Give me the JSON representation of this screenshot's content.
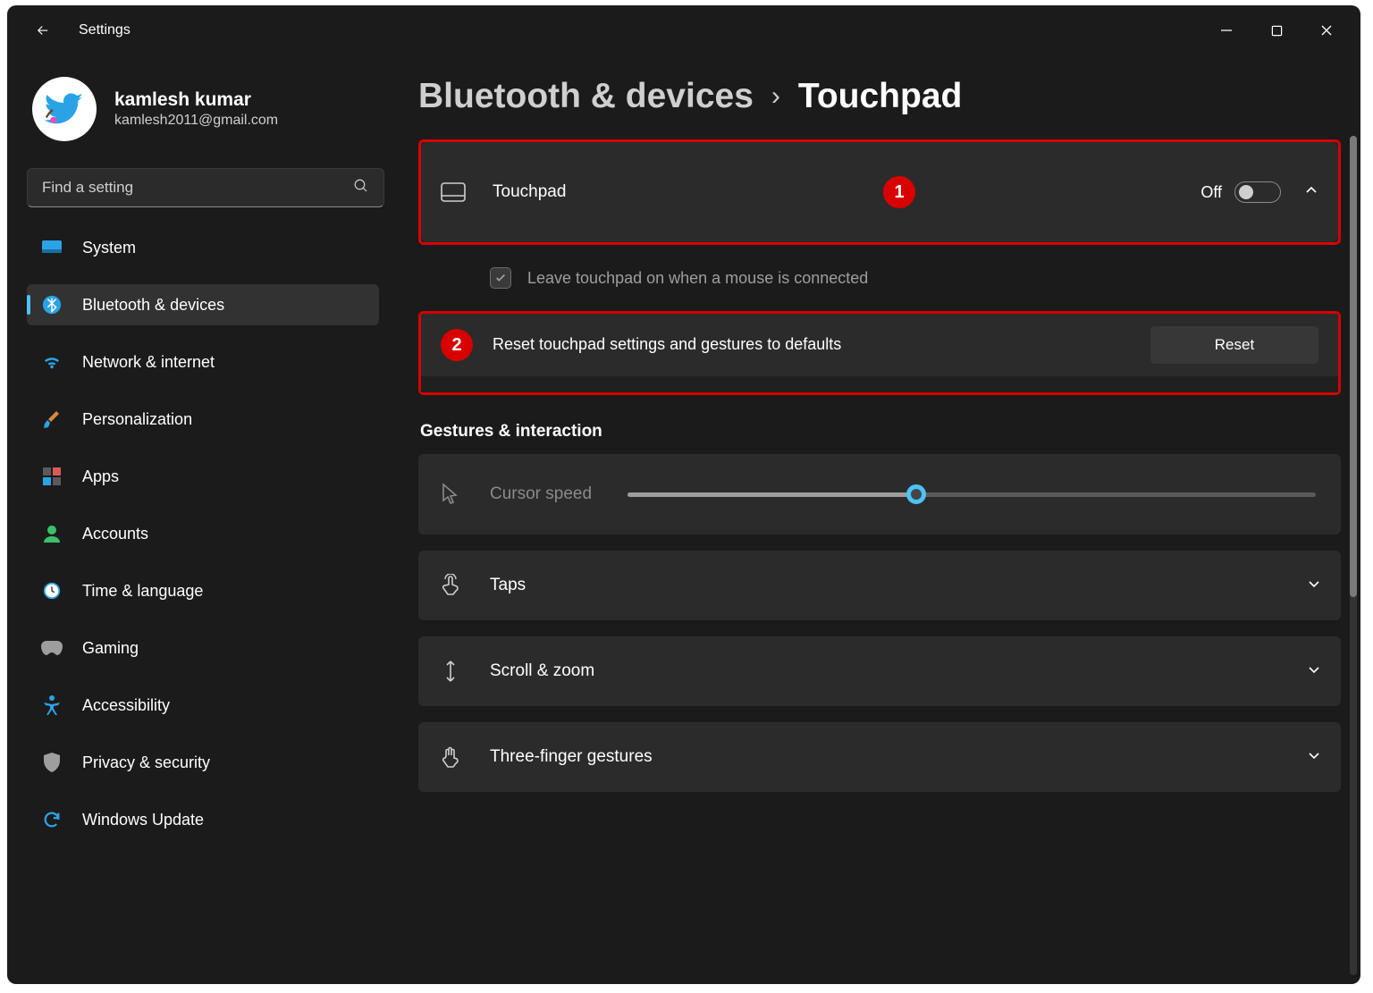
{
  "titlebar": {
    "app_name": "Settings"
  },
  "user": {
    "name": "kamlesh kumar",
    "email": "kamlesh2011@gmail.com"
  },
  "search": {
    "placeholder": "Find a setting"
  },
  "sidebar": {
    "items": [
      {
        "label": "System"
      },
      {
        "label": "Bluetooth & devices"
      },
      {
        "label": "Network & internet"
      },
      {
        "label": "Personalization"
      },
      {
        "label": "Apps"
      },
      {
        "label": "Accounts"
      },
      {
        "label": "Time & language"
      },
      {
        "label": "Gaming"
      },
      {
        "label": "Accessibility"
      },
      {
        "label": "Privacy & security"
      },
      {
        "label": "Windows Update"
      }
    ]
  },
  "breadcrumb": {
    "parent": "Bluetooth & devices",
    "current": "Touchpad"
  },
  "annotations": {
    "badge1": "1",
    "badge2": "2"
  },
  "touchpad": {
    "label": "Touchpad",
    "state_label": "Off",
    "leave_on_label": "Leave touchpad on when a mouse is connected",
    "leave_on_checked": true,
    "reset_text": "Reset touchpad settings and gestures to defaults",
    "reset_button": "Reset"
  },
  "gestures": {
    "section_title": "Gestures & interaction",
    "cursor_speed_label": "Cursor speed",
    "cursor_speed_value": 42,
    "taps_label": "Taps",
    "scroll_zoom_label": "Scroll & zoom",
    "three_finger_label": "Three-finger gestures"
  }
}
